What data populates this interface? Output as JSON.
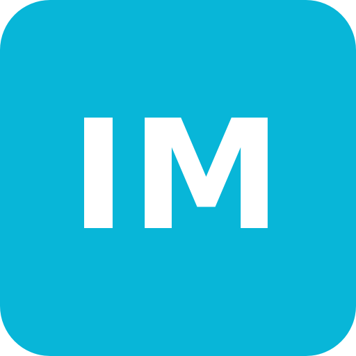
{
  "avatar": {
    "initials": "IM",
    "background_color": "#08b6d8",
    "text_color": "#ffffff"
  }
}
